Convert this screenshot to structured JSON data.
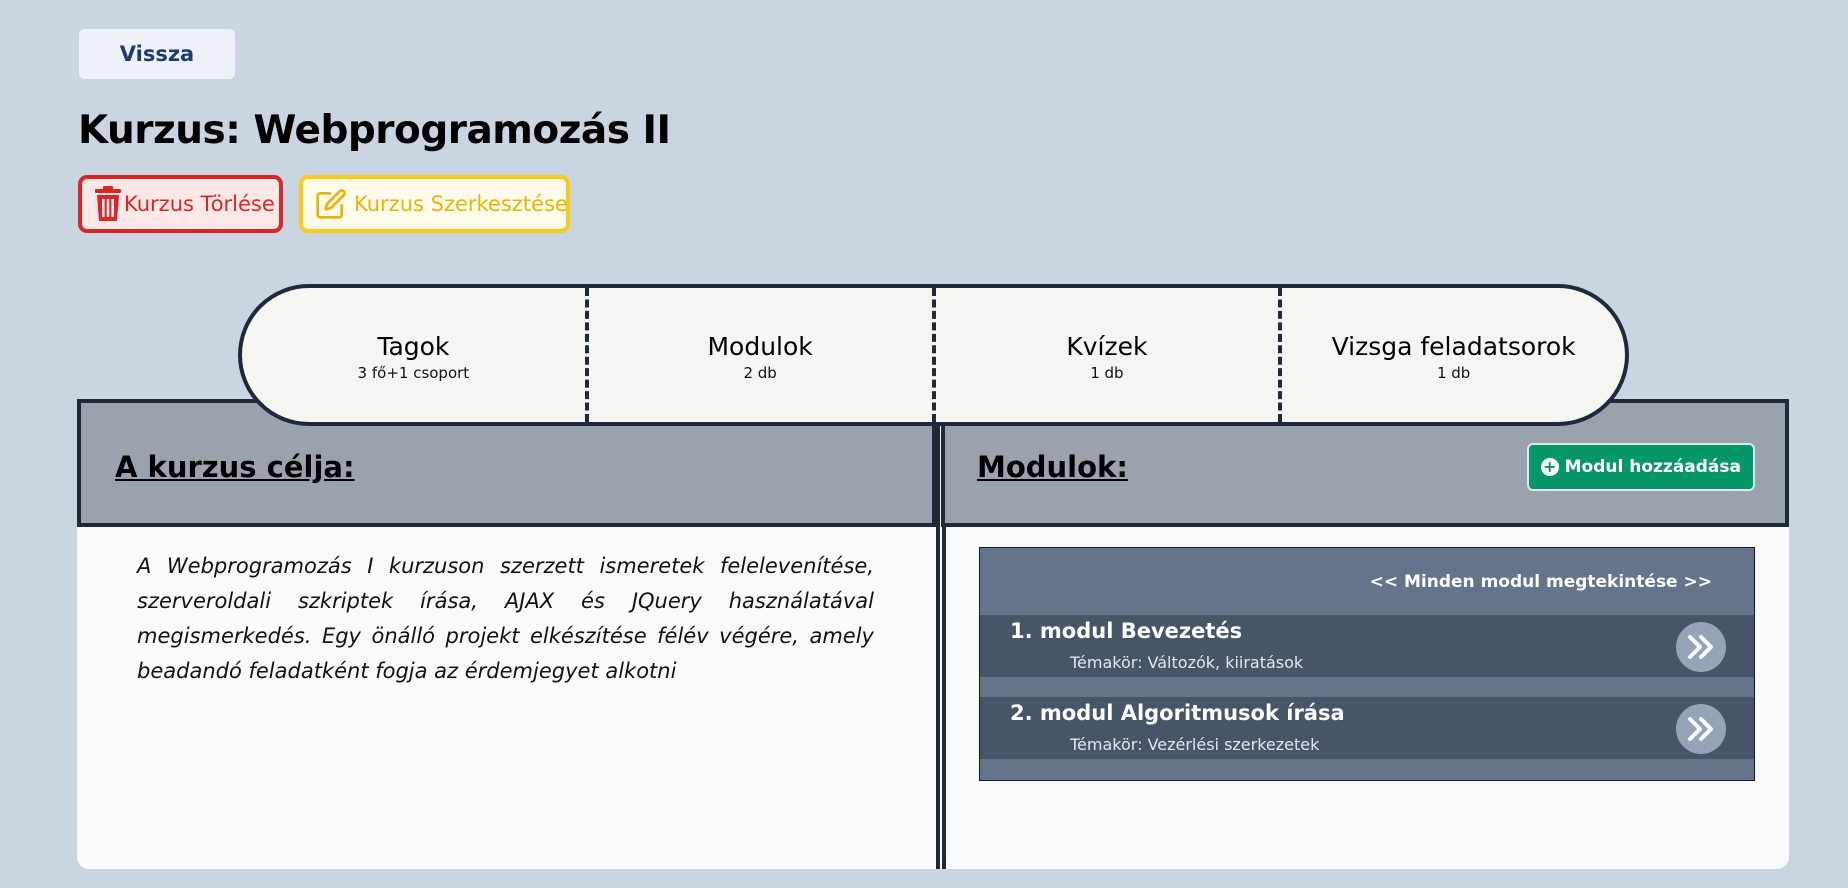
{
  "nav": {
    "back_label": "Vissza"
  },
  "page": {
    "title": "Kurzus: Webprogramozás II"
  },
  "actions": {
    "delete_label": "Kurzus Törlése",
    "edit_label": "Kurzus Szerkesztése",
    "delete_icon": "trash-icon",
    "edit_icon": "edit-icon",
    "delete_color": "#dc2626",
    "edit_color": "#facc15"
  },
  "tabs": [
    {
      "label": "Tagok",
      "sub": "3 fő+1 csoport"
    },
    {
      "label": "Modulok",
      "sub": "2 db"
    },
    {
      "label": "Kvízek",
      "sub": "1 db"
    },
    {
      "label": "Vizsga feladatsorok",
      "sub": "1 db"
    }
  ],
  "goal": {
    "title": "A kurzus célja:",
    "text": "A Webprogramozás I kurzuson szerzett ismeretek felelevenítése, szerveroldali szkriptek írása, AJAX és JQuery használatával megismerkedés. Egy önálló projekt elkészítése félév végére, amely beadandó feladatként fogja az érdemjegyet alkotni"
  },
  "modules": {
    "title": "Modulok:",
    "add_label": "Modul hozzáadása",
    "add_color": "#059669",
    "view_all_label": "<< Minden modul megtekintése >>",
    "items": [
      {
        "name": "1. modul Bevezetés",
        "topic": "Témakör: Változók, kiiratások"
      },
      {
        "name": "2. modul Algoritmusok írása",
        "topic": "Témakör: Vezérlési szerkezetek"
      }
    ]
  }
}
